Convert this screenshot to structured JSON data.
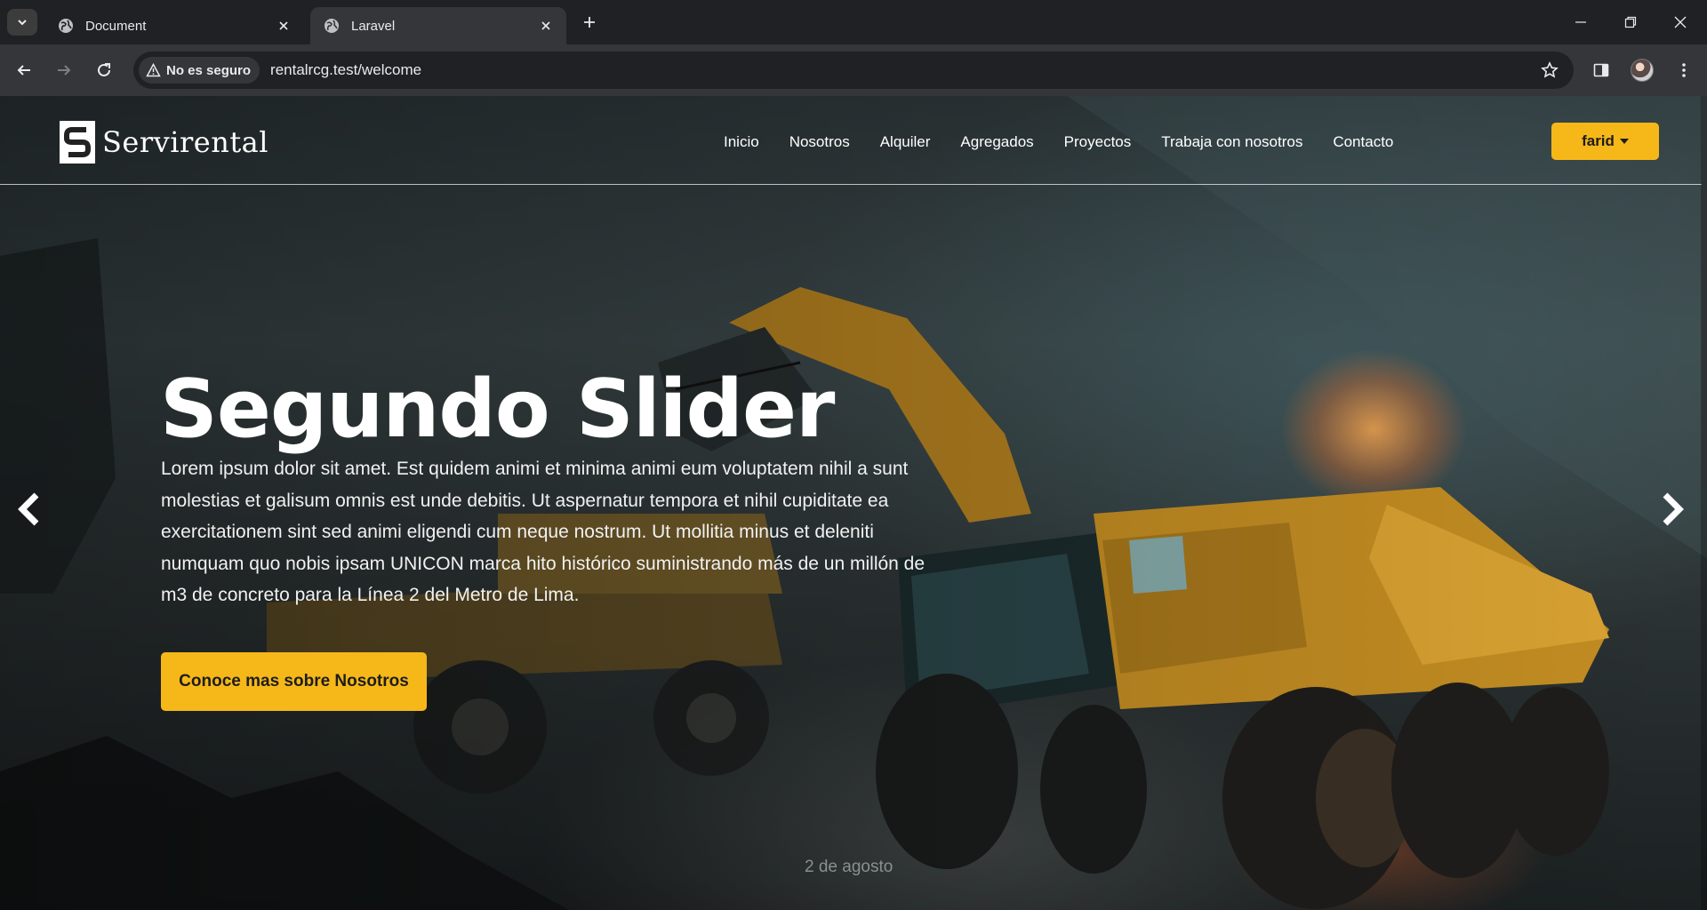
{
  "browser": {
    "tabs": [
      {
        "title": "Document",
        "active": false
      },
      {
        "title": "Laravel",
        "active": true
      }
    ],
    "security_label": "No es seguro",
    "url": "rentalrcg.test/welcome"
  },
  "site": {
    "logo_text": "Servirental",
    "nav": [
      "Inicio",
      "Nosotros",
      "Alquiler",
      "Agregados",
      "Proyectos",
      "Trabaja con nosotros",
      "Contacto"
    ],
    "user_label": "farid"
  },
  "slide": {
    "title": "Segundo Slider",
    "text": "Lorem ipsum dolor sit amet. Est quidem animi et minima animi eum voluptatem nihil a sunt molestias et galisum omnis est unde debitis. Ut aspernatur tempora et nihil cupiditate ea exercitationem sint sed animi eligendi cum neque nostrum. Ut mollitia minus et deleniti numquam quo nobis ipsam UNICON marca hito histórico suministrando más de un millón de m3 de concreto para la Línea 2 del Metro de Lima.",
    "cta_label": "Conoce mas sobre Nosotros",
    "date_text": "2 de agosto"
  },
  "colors": {
    "accent": "#f6b819",
    "chrome_bg": "#202124",
    "chrome_toolbar": "#35363a"
  },
  "icons": [
    "tab-search-icon",
    "globe-icon",
    "close-icon",
    "plus-icon",
    "minimize-icon",
    "restore-icon",
    "back-icon",
    "forward-icon",
    "reload-icon",
    "warning-icon",
    "star-icon",
    "side-panel-icon",
    "menu-icon",
    "chevron-left-icon",
    "chevron-right-icon"
  ]
}
